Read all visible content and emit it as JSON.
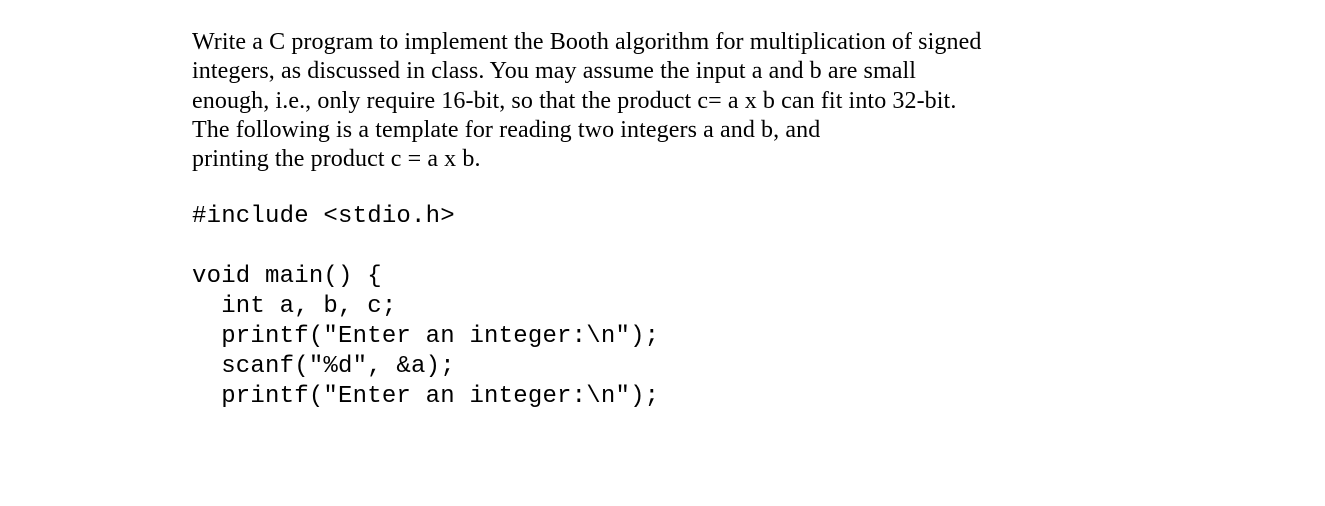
{
  "prose": {
    "l1": "Write a C program to implement the Booth algorithm for multiplication of signed",
    "l2": "integers, as discussed in class. You may assume the input a and b are small",
    "l3": "enough, i.e., only require 16-bit, so that the product c= a x b can fit into 32-bit.",
    "l4": "The following is a template for reading two integers a and b, and",
    "l5": "printing the product c = a x b."
  },
  "code": {
    "l1": "#include <stdio.h>",
    "l2": "",
    "l3": "void main() {",
    "l4": "  int a, b, c;",
    "l5": "  printf(\"Enter an integer:\\n\");",
    "l6": "  scanf(\"%d\", &a);",
    "l7": "  printf(\"Enter an integer:\\n\");"
  }
}
